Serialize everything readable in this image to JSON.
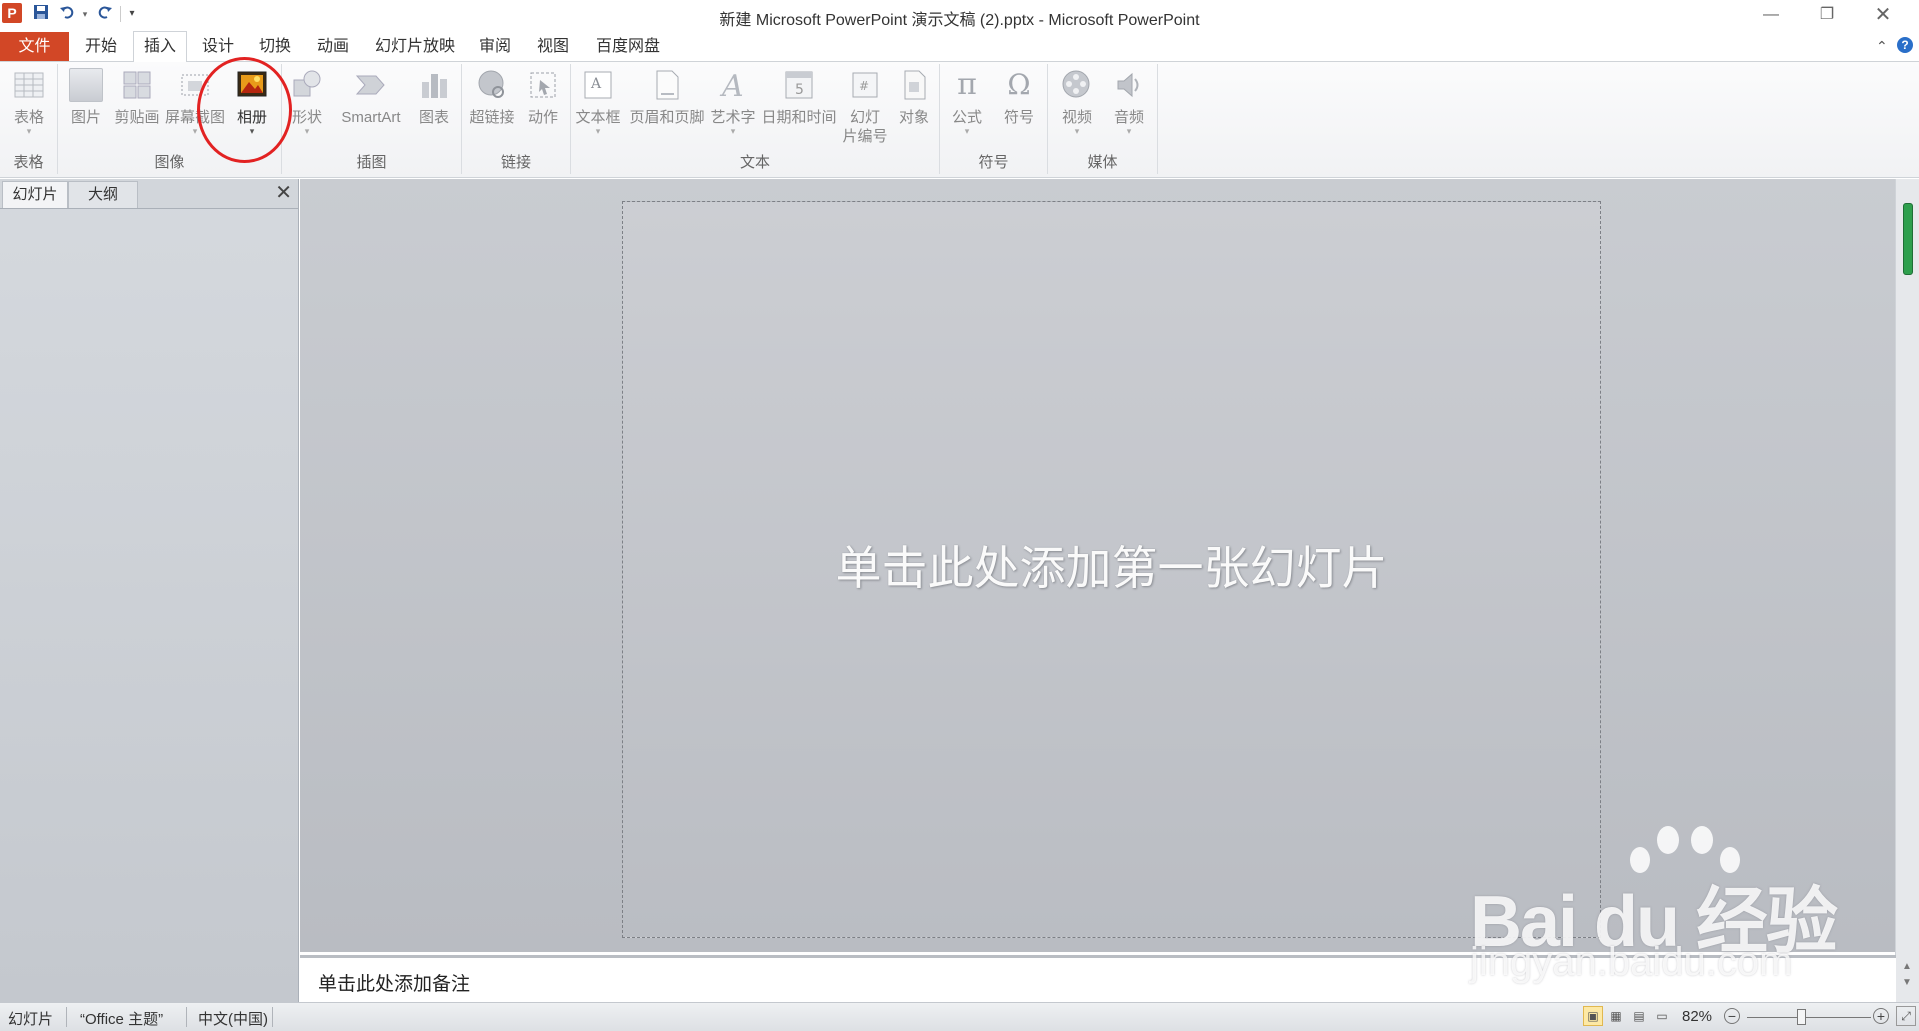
{
  "window": {
    "title": "新建 Microsoft PowerPoint 演示文稿 (2).pptx - Microsoft PowerPoint",
    "app_icon": "P",
    "qat": {
      "save_icon": "save-icon",
      "undo_icon": "undo-icon",
      "redo_icon": "redo-icon",
      "customize_icon": "customize-qat-icon"
    }
  },
  "tabs": {
    "file": "文件",
    "items": [
      "开始",
      "插入",
      "设计",
      "切换",
      "动画",
      "幻灯片放映",
      "审阅",
      "视图",
      "百度网盘"
    ],
    "active": "插入"
  },
  "ribbon": {
    "groups": {
      "table": "表格",
      "images": "图像",
      "illustrations": "插图",
      "links": "链接",
      "text": "文本",
      "symbols": "符号",
      "media": "媒体"
    },
    "buttons": {
      "table": "表格",
      "picture": "图片",
      "clipart": "剪贴画",
      "screenshot": "屏幕截图",
      "album": "相册",
      "shapes": "形状",
      "smartart": "SmartArt",
      "chart": "图表",
      "hyperlink": "超链接",
      "action": "动作",
      "textbox": "文本框",
      "header_footer": "页眉和页脚",
      "wordart": "艺术字",
      "datetime": "日期和时间",
      "slide_number_1": "幻灯",
      "slide_number_2": "片编号",
      "object": "对象",
      "equation": "公式",
      "symbol": "符号",
      "video": "视频",
      "audio": "音频"
    }
  },
  "left_panel": {
    "tabs": [
      "幻灯片",
      "大纲"
    ],
    "active_tab": "幻灯片"
  },
  "slide": {
    "placeholder": "单击此处添加第一张幻灯片"
  },
  "notes": {
    "placeholder": "单击此处添加备注"
  },
  "status_bar": {
    "slide": "幻灯片",
    "theme": "“Office 主题”",
    "language": "中文(中国)",
    "zoom": "82%",
    "zoom_level": 0.44
  },
  "watermark": {
    "brand": "Bai du 经验",
    "url": "jingyan.baidu.com"
  },
  "colors": {
    "accent": "#d24726",
    "highlight": "#e22222",
    "scroll_thumb": "#2e9f4d"
  }
}
